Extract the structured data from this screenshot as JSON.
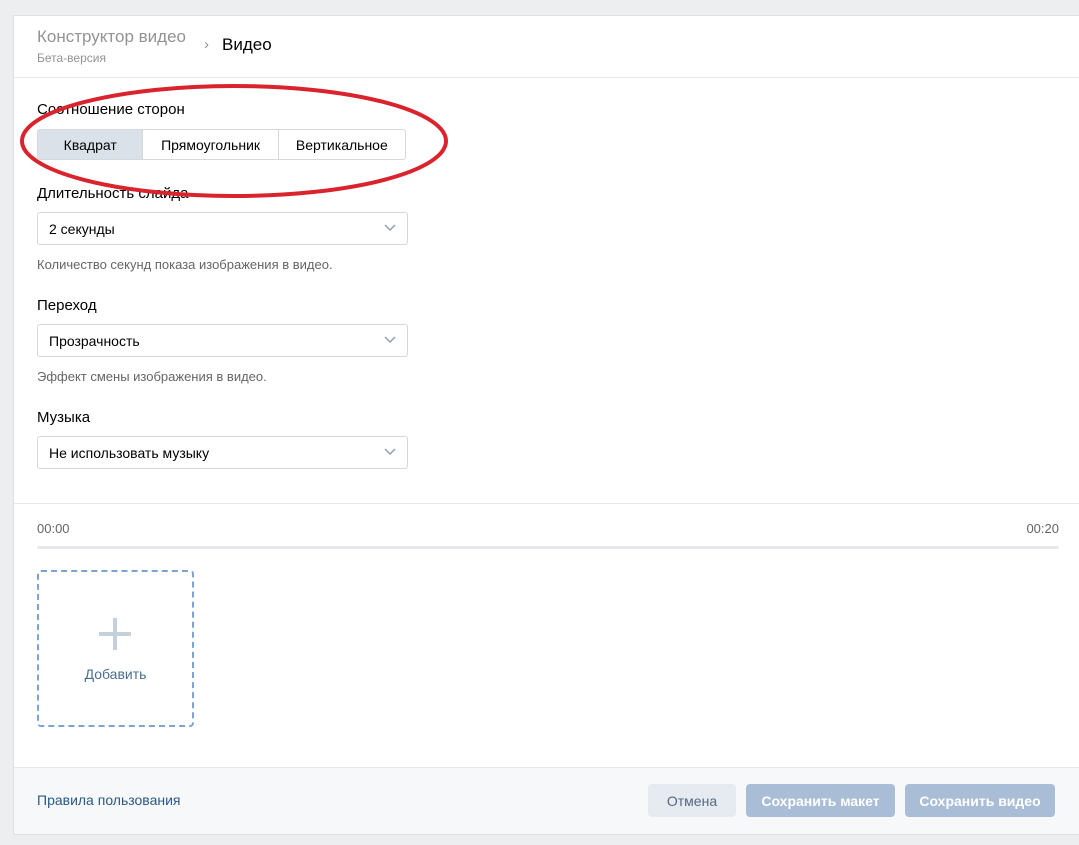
{
  "header": {
    "app_title": "Конструктор видео",
    "app_subtitle": "Бета-версия",
    "separator": "›",
    "current": "Видео"
  },
  "aspect": {
    "label": "Соотношение сторон",
    "options": [
      "Квадрат",
      "Прямоугольник",
      "Вертикальное"
    ],
    "selected": "Квадрат"
  },
  "duration": {
    "label": "Длительность слайда",
    "value": "2 секунды",
    "hint": "Количество секунд показа изображения в видео."
  },
  "transition": {
    "label": "Переход",
    "value": "Прозрачность",
    "hint": "Эффект смены изображения в видео."
  },
  "music": {
    "label": "Музыка",
    "value": "Не использовать музыку"
  },
  "timeline": {
    "start": "00:00",
    "end": "00:20"
  },
  "add_tile": {
    "label": "Добавить",
    "icon": "plus-icon"
  },
  "footer": {
    "terms": "Правила пользования",
    "cancel": "Отмена",
    "save_draft": "Сохранить макет",
    "save_video": "Сохранить видео"
  },
  "colors": {
    "annotation": "#d9232d",
    "segment_active": "#dae1e8",
    "primary_disabled": "#a9bed6",
    "link": "#2a5885"
  }
}
